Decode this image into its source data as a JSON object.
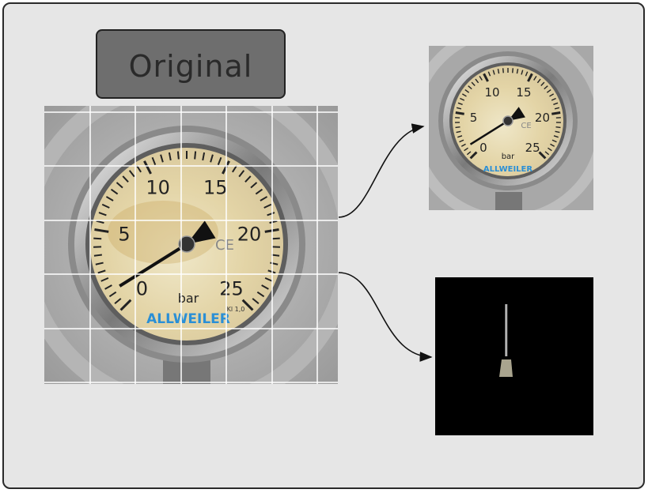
{
  "title": "Original",
  "gauge": {
    "scale_labels": [
      "0",
      "5",
      "10",
      "15",
      "20",
      "25"
    ],
    "unit": "bar",
    "brand": "ALLWEILER",
    "class_mark": "Kl 1,0",
    "ce_mark": "CE",
    "needle_value": 1.2
  },
  "grid": {
    "columns": 6,
    "rows": 5
  },
  "colors": {
    "panel_bg": "#e6e6e6",
    "title_box": "#6e6e6e",
    "brand_blue": "#2a8fd6",
    "dial_face": "#e8dfc0",
    "mask_bg": "#000000"
  }
}
